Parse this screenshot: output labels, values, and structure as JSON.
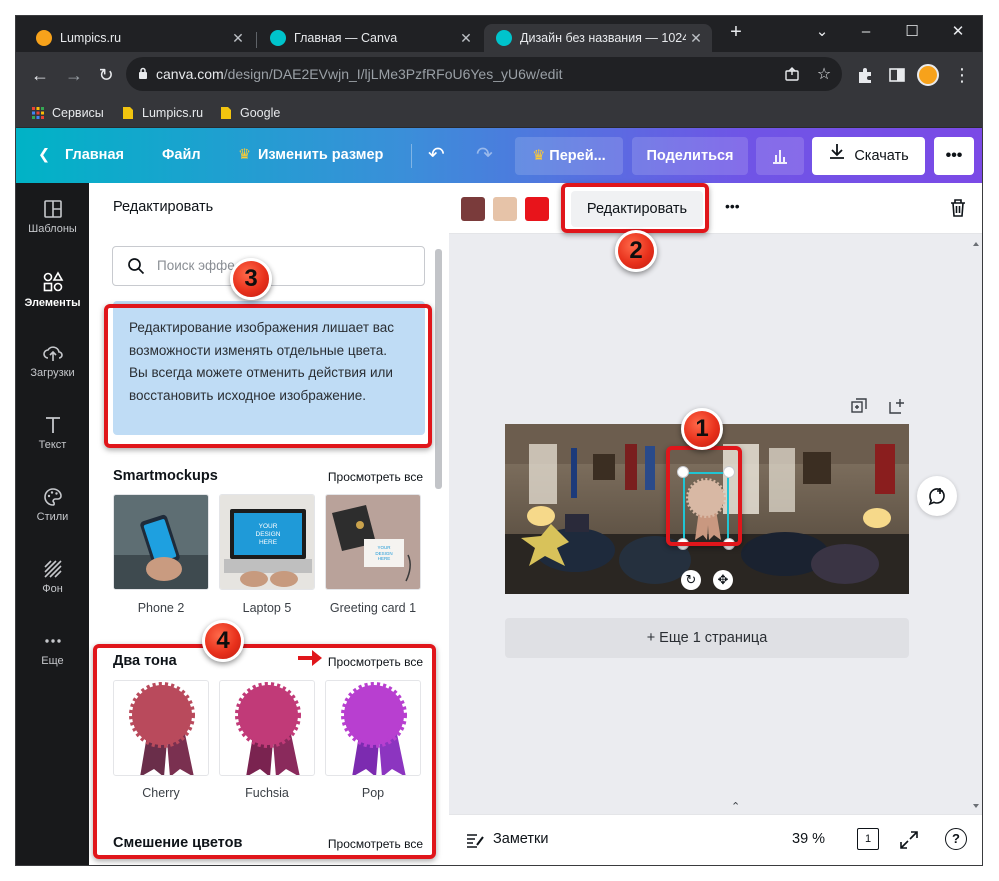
{
  "browser": {
    "tabs": [
      {
        "title": "Lumpics.ru",
        "favicon_color": "#f7a21b"
      },
      {
        "title": "Главная — Canva",
        "favicon_color": "#00c4cc"
      },
      {
        "title": "Дизайн без названия — 1024",
        "favicon_color": "#00c4cc"
      }
    ],
    "new_tab": "+",
    "url_host": "canva.com",
    "url_path": "/design/DAE2EVwjn_I/ljLMe3PzfRFoU6Yes_yU6w/edit",
    "bookmarks": [
      "Сервисы",
      "Lumpics.ru",
      "Google"
    ]
  },
  "topbar": {
    "home": "Главная",
    "file": "Файл",
    "resize": "Изменить размер",
    "upgrade": "Перей...",
    "share": "Поделиться",
    "download": "Скачать"
  },
  "rail": [
    {
      "label": "Шаблоны",
      "icon": "templates-icon"
    },
    {
      "label": "Элементы",
      "icon": "elements-icon"
    },
    {
      "label": "Загрузки",
      "icon": "uploads-icon"
    },
    {
      "label": "Текст",
      "icon": "text-icon"
    },
    {
      "label": "Стили",
      "icon": "styles-icon"
    },
    {
      "label": "Фон",
      "icon": "background-icon"
    },
    {
      "label": "Еще",
      "icon": "more-icon"
    }
  ],
  "panel": {
    "title": "Редактировать",
    "search_placeholder": "Поиск эффе",
    "info_text": "Редактирование изображения лишает вас возможности изменять отдельные цвета. Вы всегда можете отменить действия или восстановить исходное изображение.",
    "sections": [
      {
        "title": "Smartmockups",
        "link": "Просмотреть все",
        "items": [
          "Phone 2",
          "Laptop 5",
          "Greeting card 1"
        ]
      },
      {
        "title": "Два тона",
        "link": "Просмотреть все",
        "items": [
          "Cherry",
          "Fuchsia",
          "Pop"
        ]
      },
      {
        "title": "Смешение цветов",
        "link": "Просмотреть все"
      }
    ],
    "mockup_screen_text": "YOUR DESIGN HERE"
  },
  "context_bar": {
    "swatches": [
      "#7a3b3b",
      "#e6c3a8",
      "#e8141b"
    ],
    "edit_button": "Редактировать",
    "more": "•••"
  },
  "workspace": {
    "add_page": "+ Еще 1 страница"
  },
  "footer": {
    "notes": "Заметки",
    "zoom": "39 %",
    "page_number": "1",
    "help": "?"
  },
  "annotations": [
    "1",
    "2",
    "3",
    "4"
  ],
  "colors": {
    "annotation_red": "#e0161b",
    "info_bg": "#bfdcf5",
    "cherry": "#b94a5c",
    "fuchsia": "#c13a78",
    "pop": "#b83fd0"
  }
}
